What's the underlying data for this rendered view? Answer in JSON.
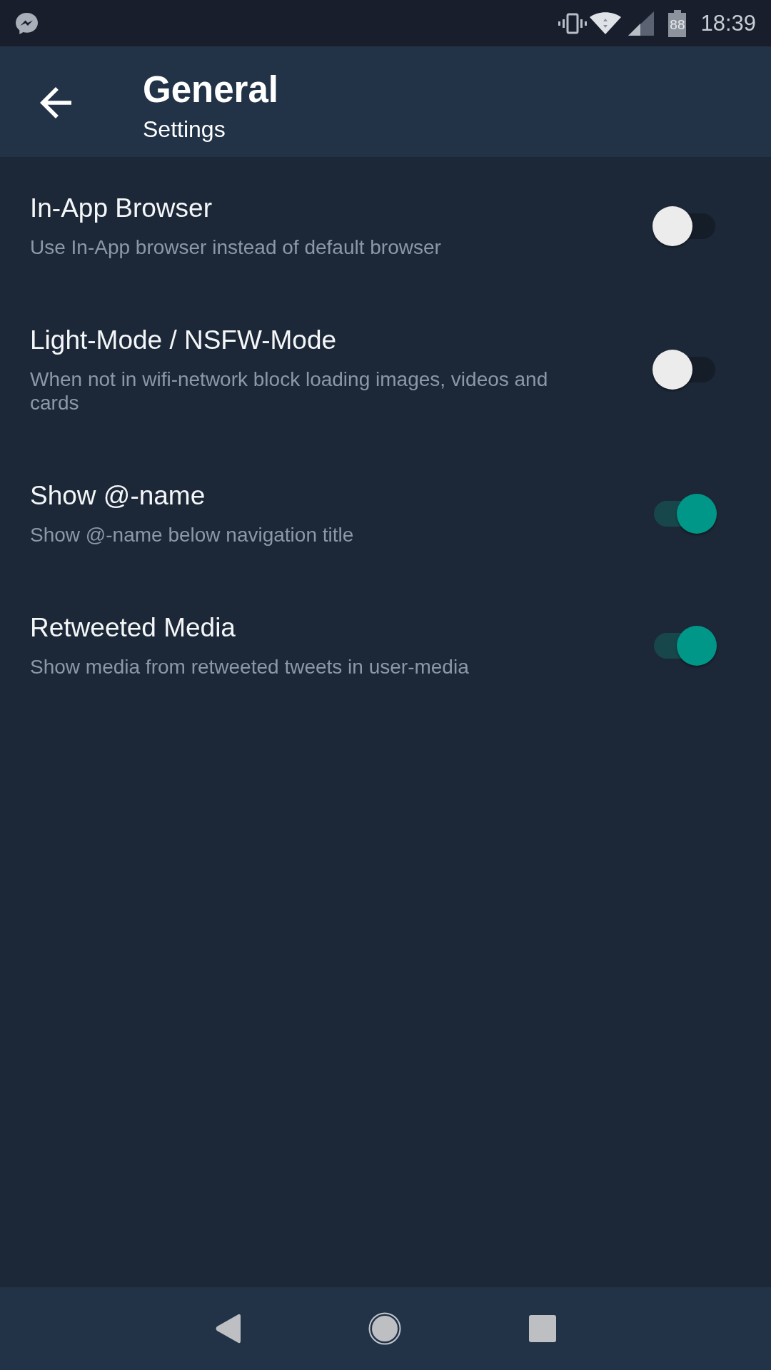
{
  "status_bar": {
    "battery": "88",
    "time": "18:39"
  },
  "header": {
    "title": "General",
    "subtitle": "Settings"
  },
  "settings": [
    {
      "title": "In-App Browser",
      "description": "Use In-App browser instead of default browser",
      "on": false
    },
    {
      "title": "Light-Mode / NSFW-Mode",
      "description": "When not in wifi-network block loading images, videos and cards",
      "on": false
    },
    {
      "title": "Show @-name",
      "description": "Show @-name below navigation title",
      "on": true
    },
    {
      "title": "Retweeted Media",
      "description": "Show media from retweeted tweets in user-media",
      "on": true
    }
  ]
}
